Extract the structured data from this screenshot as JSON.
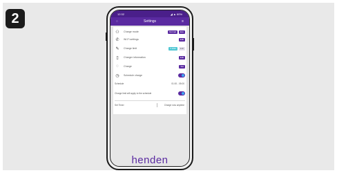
{
  "step": "2",
  "phone": {
    "status_time": "12:32",
    "status_right": "◢ ▲ 60%",
    "title": "Settings",
    "back": "◌",
    "menu": "≡",
    "rows": [
      {
        "icon": "⚇",
        "label": "Charge mode",
        "pills": [
          "Normal",
          "Eco"
        ]
      },
      {
        "icon": "✆",
        "label": "Wi-Fi settings",
        "pills": [
          "Edit"
        ]
      },
      {
        "icon": "✎",
        "label": "Charge limit",
        "pills": [
          "5 kWh",
          "Edit"
        ]
      },
      {
        "icon": "▯",
        "label": "Charger information",
        "pills": [
          "Edit"
        ]
      },
      {
        "icon": "◌",
        "label": "Charge",
        "pills": [
          "Set"
        ]
      },
      {
        "icon": "◷",
        "label": "Schedule charge",
        "toggle": true
      }
    ],
    "schedule_label": "Schedule",
    "schedule_value": "01:00 - 05:00",
    "fine_text": "Charge limit will apply to the schedule",
    "footer_left": "Set Timer",
    "footer_right": "Charge now anytime",
    "brand": "henden"
  },
  "colors": {
    "accent": "#5a2aa0",
    "toggle_knob": "#3fa9f5",
    "teal": "#4fc7d3"
  }
}
